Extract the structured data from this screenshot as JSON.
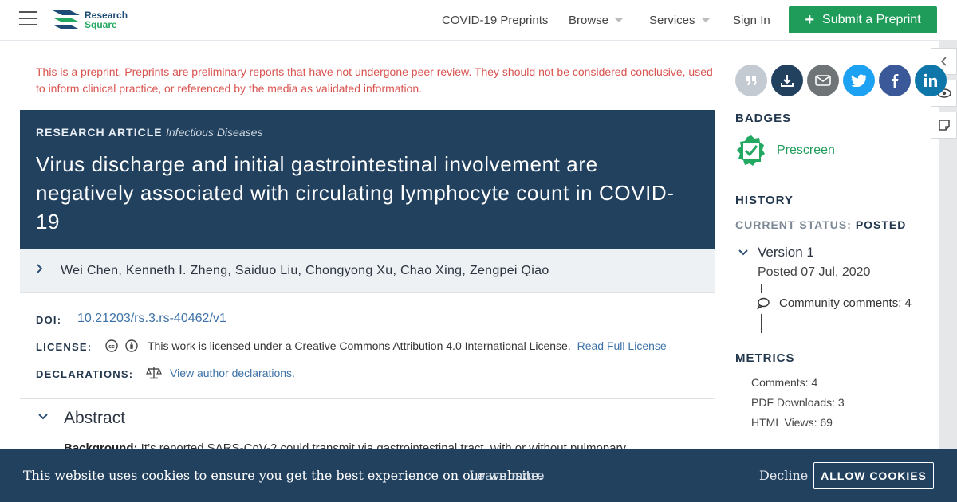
{
  "header": {
    "logo_line1": "Research",
    "logo_line2": "Square",
    "nav": {
      "covid": "COVID-19 Preprints",
      "browse": "Browse",
      "services": "Services",
      "signin": "Sign In"
    },
    "submit_label": "Submit a Preprint",
    "accent_color": "#1f9c5a"
  },
  "warning": "This is a preprint. Preprints are preliminary reports that have not undergone peer review. They should not be considered conclusive, used to inform clinical practice, or referenced by the media as validated information.",
  "article": {
    "type": "RESEARCH ARTICLE",
    "subject": "Infectious Diseases",
    "title": "Virus discharge and initial gastrointestinal involvement are negatively associated with circulating lymphocyte count in COVID-19",
    "authors": "Wei Chen, Kenneth I. Zheng, Saiduo Liu, Chongyong Xu, Chao Xing, Zengpei Qiao",
    "doi_label": "DOI:",
    "doi": "10.21203/rs.3.rs-40462/v1",
    "license_label": "LICENSE:",
    "license_text": "This work is licensed under a Creative Commons Attribution 4.0 International License.",
    "license_link": "Read Full License",
    "declarations_label": "DECLARATIONS:",
    "declarations_link": "View author declarations.",
    "abstract_title": "Abstract",
    "abstract_lead": "Background:",
    "abstract_text": " It’s reported SARS-CoV-2 could transmit via gastrointestinal tract, with or without pulmonary"
  },
  "sidebar": {
    "badges_heading": "BADGES",
    "badge_label": "Prescreen",
    "history_heading": "HISTORY",
    "status_key": "CURRENT STATUS:",
    "status_value": "POSTED",
    "version_title": "Version 1",
    "version_posted": "Posted 07 Jul, 2020",
    "community_comments": "Community comments: 4",
    "metrics_heading": "METRICS",
    "metrics": {
      "comments": "Comments: 4",
      "pdf": "PDF Downloads: 3",
      "html": "HTML Views: 69"
    }
  },
  "share_icons": [
    "quote-icon",
    "download-icon",
    "email-icon",
    "twitter-icon",
    "facebook-icon",
    "linkedin-icon"
  ],
  "cookie": {
    "message": "This website uses cookies to ensure you get the best experience on our website.",
    "learn_more": "Learn more",
    "decline": "Decline",
    "allow": "ALLOW COOKIES"
  }
}
